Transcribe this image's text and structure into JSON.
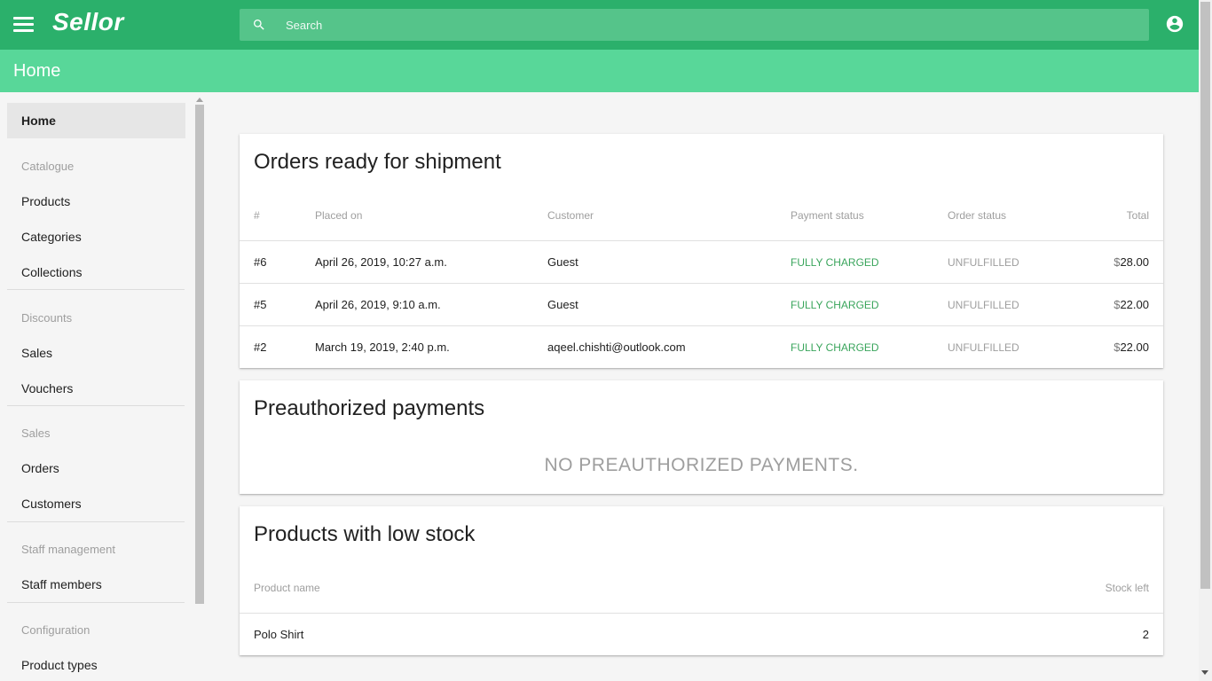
{
  "app": {
    "logo": "Sellor",
    "search_placeholder": "Search",
    "page_title": "Home"
  },
  "sidebar": {
    "home": "Home",
    "sections": {
      "catalogue": "Catalogue",
      "discounts": "Discounts",
      "sales": "Sales",
      "staff": "Staff management",
      "configuration": "Configuration"
    },
    "items": {
      "products": "Products",
      "categories": "Categories",
      "collections": "Collections",
      "sales": "Sales",
      "vouchers": "Vouchers",
      "orders": "Orders",
      "customers": "Customers",
      "staff_members": "Staff members",
      "product_types": "Product types"
    }
  },
  "orders_card": {
    "title": "Orders ready for shipment",
    "columns": [
      "#",
      "Placed on",
      "Customer",
      "Payment status",
      "Order status",
      "Total"
    ],
    "currency_symbol": "$",
    "rows": [
      {
        "num": "#6",
        "placed": "April 26, 2019, 10:27 a.m.",
        "customer": "Guest",
        "payment": "FULLY CHARGED",
        "status": "UNFULFILLED",
        "total": "28.00"
      },
      {
        "num": "#5",
        "placed": "April 26, 2019, 9:10 a.m.",
        "customer": "Guest",
        "payment": "FULLY CHARGED",
        "status": "UNFULFILLED",
        "total": "22.00"
      },
      {
        "num": "#2",
        "placed": "March 19, 2019, 2:40 p.m.",
        "customer": "aqeel.chishti@outlook.com",
        "payment": "FULLY CHARGED",
        "status": "UNFULFILLED",
        "total": "22.00"
      }
    ]
  },
  "preauth_card": {
    "title": "Preauthorized payments",
    "empty": "NO PREAUTHORIZED PAYMENTS."
  },
  "stock_card": {
    "title": "Products with low stock",
    "columns": [
      "Product name",
      "Stock left"
    ],
    "rows": [
      {
        "name": "Polo Shirt",
        "stock": "2"
      }
    ]
  },
  "colors": {
    "topbar": "#2bb06b",
    "titlebar": "#58d799",
    "payment_status": "#3aa55c"
  },
  "icons": {
    "menu": "menu-icon",
    "search": "search-icon",
    "user": "account-circle-icon"
  }
}
